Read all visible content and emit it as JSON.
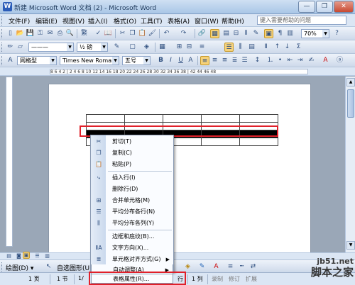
{
  "window": {
    "title": "新建 Microsoft Word 文档 (2) - Microsoft Word",
    "app_icon": "W"
  },
  "menubar": {
    "items": [
      "文件(F)",
      "编辑(E)",
      "视图(V)",
      "插入(I)",
      "格式(O)",
      "工具(T)",
      "表格(A)",
      "窗口(W)",
      "帮助(H)"
    ],
    "help_placeholder": "键入需要帮助的问题"
  },
  "toolbar_standard": {
    "zoom": "70%"
  },
  "toolbar_table": {
    "line_weight": "½ 磅"
  },
  "toolbar_format": {
    "style": "网格型",
    "font": "Times New Roman",
    "size": "五号"
  },
  "ruler": {
    "marks": "8 6 4 2 | 2 4 6 8 10 12 14 16 18 20 22 24 26 28 30 32 34 36 38 | 42 44 46 48"
  },
  "context_menu": {
    "items": [
      {
        "label": "剪切(T)",
        "icon": "cut-icon",
        "glyph": "✂"
      },
      {
        "label": "复制(C)",
        "icon": "copy-icon",
        "glyph": "❐"
      },
      {
        "label": "粘贴(P)",
        "icon": "paste-icon",
        "glyph": "📋"
      },
      {
        "label": "插入行(I)",
        "icon": "insert-row-icon",
        "glyph": "⤷"
      },
      {
        "label": "删除行(D)",
        "icon": "delete-row-icon",
        "glyph": ""
      },
      {
        "label": "合并单元格(M)",
        "icon": "merge-cells-icon",
        "glyph": "⊞"
      },
      {
        "label": "平均分布各行(N)",
        "icon": "distribute-rows-icon",
        "glyph": "☰"
      },
      {
        "label": "平均分布各列(Y)",
        "icon": "distribute-columns-icon",
        "glyph": "⫼"
      },
      {
        "label": "边框和底纹(B)...",
        "icon": "borders-icon",
        "glyph": ""
      },
      {
        "label": "文字方向(X)...",
        "icon": "text-direction-icon",
        "glyph": "ⅡA"
      },
      {
        "label": "单元格对齐方式(G)",
        "icon": "cell-alignment-icon",
        "glyph": "≣"
      },
      {
        "label": "自动调整(A)",
        "icon": "autofit-icon",
        "glyph": ""
      },
      {
        "label": "表格属性(R)...",
        "icon": "table-properties-icon",
        "glyph": ""
      }
    ],
    "submenu_arrow": "▶"
  },
  "drawing_toolbar": {
    "draw_label": "绘图(D) ▾",
    "autoshapes_label": "自选图形(U) ▾"
  },
  "status_bar": {
    "page": "1 页",
    "section": "1 节",
    "page_of": "1/",
    "line": "行",
    "col": "1 列",
    "rec": "录制",
    "trk": "修订",
    "ext": "扩展"
  },
  "watermark": {
    "url": "jb51.net",
    "brand": "脚本之家"
  },
  "colors": {
    "selection_highlight": "#e0202a",
    "menubar_bg": "#dbe6f4",
    "workspace_bg": "#9aa7b7"
  }
}
